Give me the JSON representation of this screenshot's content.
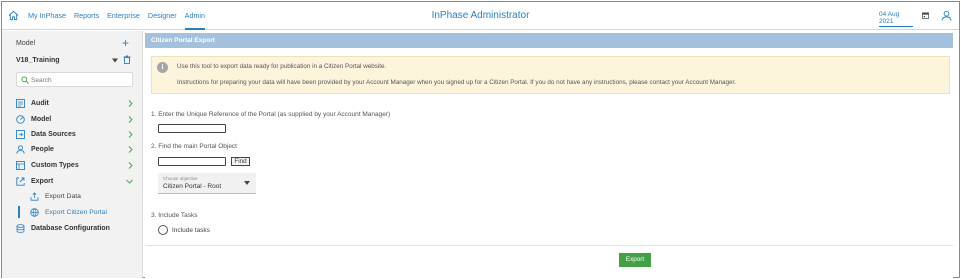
{
  "nav": {
    "items": [
      "My InPhase",
      "Reports",
      "Enterprise",
      "Designer",
      "Admin"
    ],
    "active": "Admin",
    "app_title": "InPhase Administrator",
    "date": "04 Aug 2021"
  },
  "sidebar": {
    "model_label": "Model",
    "model_name": "V18_Training",
    "search_placeholder": "Search",
    "items": [
      {
        "label": "Audit",
        "icon": "audit-icon"
      },
      {
        "label": "Model",
        "icon": "model-icon"
      },
      {
        "label": "Data Sources",
        "icon": "data-sources-icon"
      },
      {
        "label": "People",
        "icon": "people-icon"
      },
      {
        "label": "Custom Types",
        "icon": "custom-types-icon"
      },
      {
        "label": "Export",
        "icon": "export-icon"
      }
    ],
    "export_sub": [
      {
        "label": "Export Data",
        "icon": "export-data-icon"
      },
      {
        "label": "Export Citizen Portal",
        "icon": "citizen-portal-icon"
      }
    ],
    "database_config": "Database Configuration"
  },
  "main": {
    "panel_title": "Citizen Portal Export",
    "info_line1": "Use this tool to export data ready for publication in a Citizen Portal website.",
    "info_line2": "Instructions for preparing your data will have been provided by your Account Manager when you signed up for a Citizen Portal. If you do not have any instructions, please contact your Account Manager.",
    "step1": "1. Enter the Unique Reference of the Portal (as supplied by your Account Manager)",
    "step1_value": "",
    "step2": "2. Find the main Portal Object",
    "step2_value": "",
    "find_label": "Find",
    "select_caption": "Choose objective",
    "select_value": "Citizen Portal - Root",
    "step3": "3. Include Tasks",
    "include_tasks_label": "Include tasks",
    "export_label": "Export"
  },
  "colors": {
    "accent": "#2a7fc1",
    "panel_header": "#a3c1dd",
    "info_bg": "#fdf4dc",
    "export_button": "#43a047",
    "sidebar_bg": "#f2f2f2"
  }
}
